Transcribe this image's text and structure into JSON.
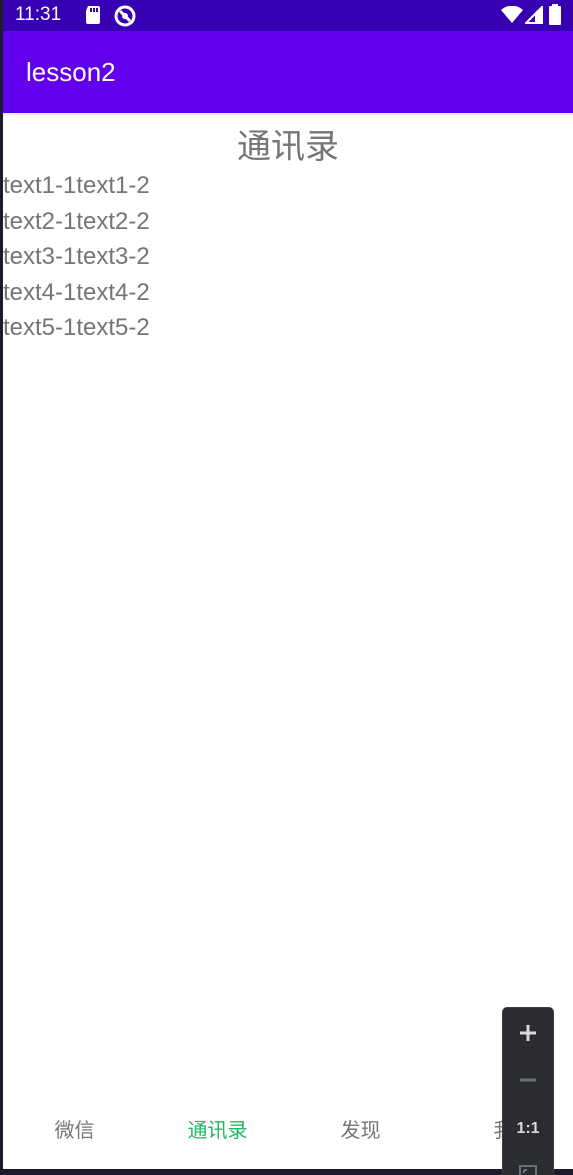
{
  "status_bar": {
    "time": "11:31",
    "icons": [
      "sd-card-icon",
      "no-sync-icon",
      "wifi-icon",
      "signal-icon",
      "battery-icon"
    ]
  },
  "app_bar": {
    "title": "lesson2"
  },
  "page": {
    "title": "通讯录",
    "rows": [
      "text1-1text1-2",
      "text2-1text2-2",
      "text3-1text3-2",
      "text4-1text4-2",
      "text5-1text5-2"
    ]
  },
  "bottom_nav": {
    "tabs": [
      {
        "label": "微信"
      },
      {
        "label": "通讯录"
      },
      {
        "label": "发现"
      },
      {
        "label": "我"
      }
    ],
    "active_index": 1,
    "active_color": "#1fb862",
    "inactive_color": "#757575"
  },
  "zoom_control": {
    "zoom_in_icon": "plus-icon",
    "zoom_out_icon": "minus-icon",
    "actual_size_label": "1:1",
    "fit_icon": "fit-screen-icon"
  },
  "colors": {
    "status_bar": "#3700b3",
    "app_bar": "#6200ee"
  }
}
